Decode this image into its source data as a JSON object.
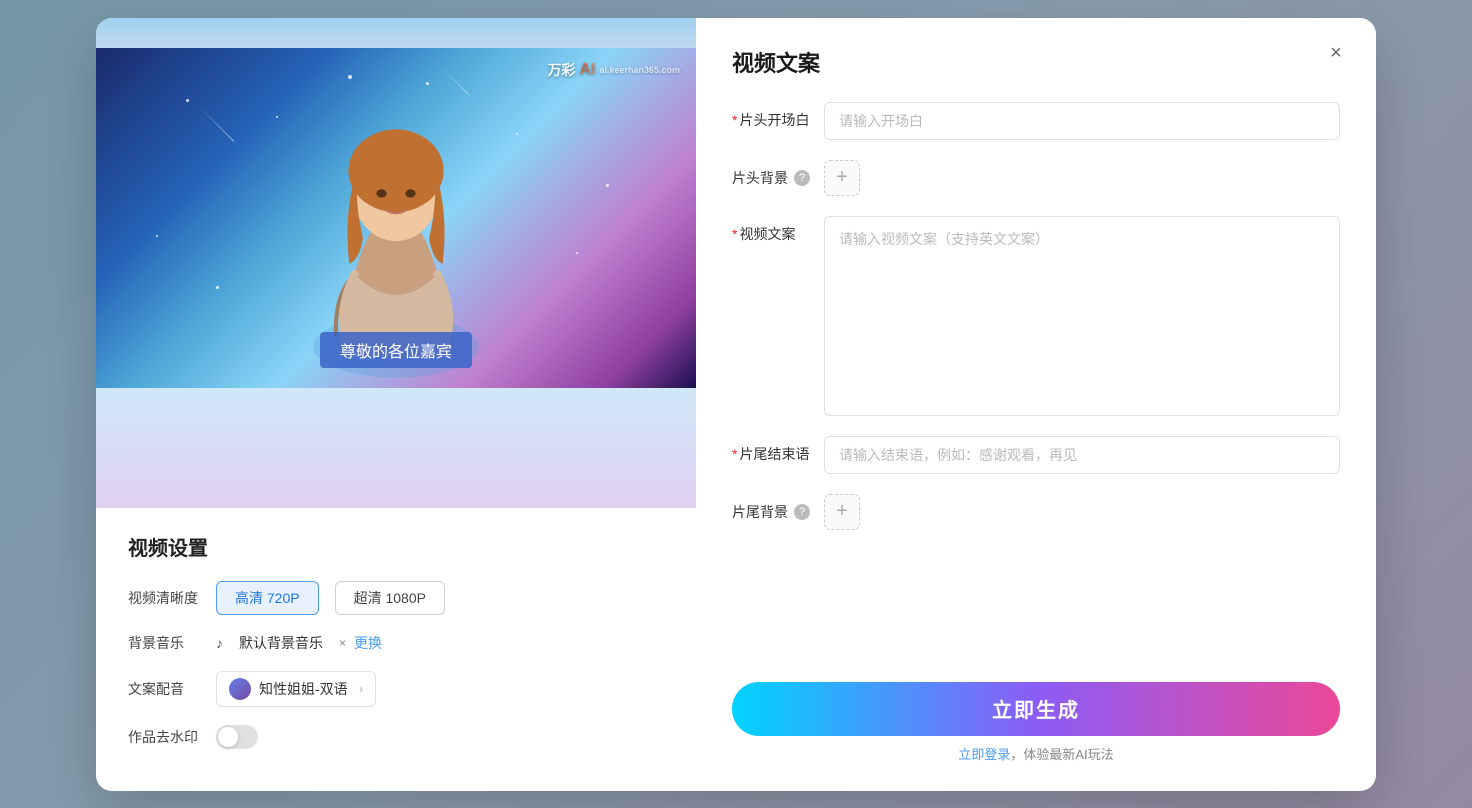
{
  "modal": {
    "close_label": "×"
  },
  "watermark": {
    "brand": "万彩",
    "ai": "AI",
    "sub": "ai.keerhan365.com"
  },
  "subtitle": "尊敬的各位嘉宾",
  "left": {
    "settings_title": "视频设置",
    "quality_label": "视频清晰度",
    "quality_options": [
      {
        "label": "高清 720P",
        "active": true
      },
      {
        "label": "超清 1080P",
        "active": false
      }
    ],
    "music_label": "背景音乐",
    "music_icon": "♪",
    "music_name": "默认背景音乐",
    "music_x": "×",
    "music_change": "更换",
    "voice_label": "文案配音",
    "voice_name": "知性姐姐-双语",
    "voice_arrow": "›",
    "watermark_label": "作品去水印"
  },
  "right": {
    "title": "视频文案",
    "opening_label": "片头开场白",
    "opening_required": "*",
    "opening_placeholder": "请输入开场白",
    "bg_label": "片头背景",
    "bg_add": "+",
    "video_copy_label": "视频文案",
    "video_copy_required": "*",
    "video_copy_placeholder": "请输入视频文案（支持英文文案）",
    "closing_label": "片尾结束语",
    "closing_required": "*",
    "closing_placeholder": "请输入结束语，例如：感谢观看，再见",
    "tail_bg_label": "片尾背景",
    "tail_bg_add": "+",
    "generate_btn": "立即生成",
    "generate_hint": "立即登录，体验最新AI玩法"
  }
}
